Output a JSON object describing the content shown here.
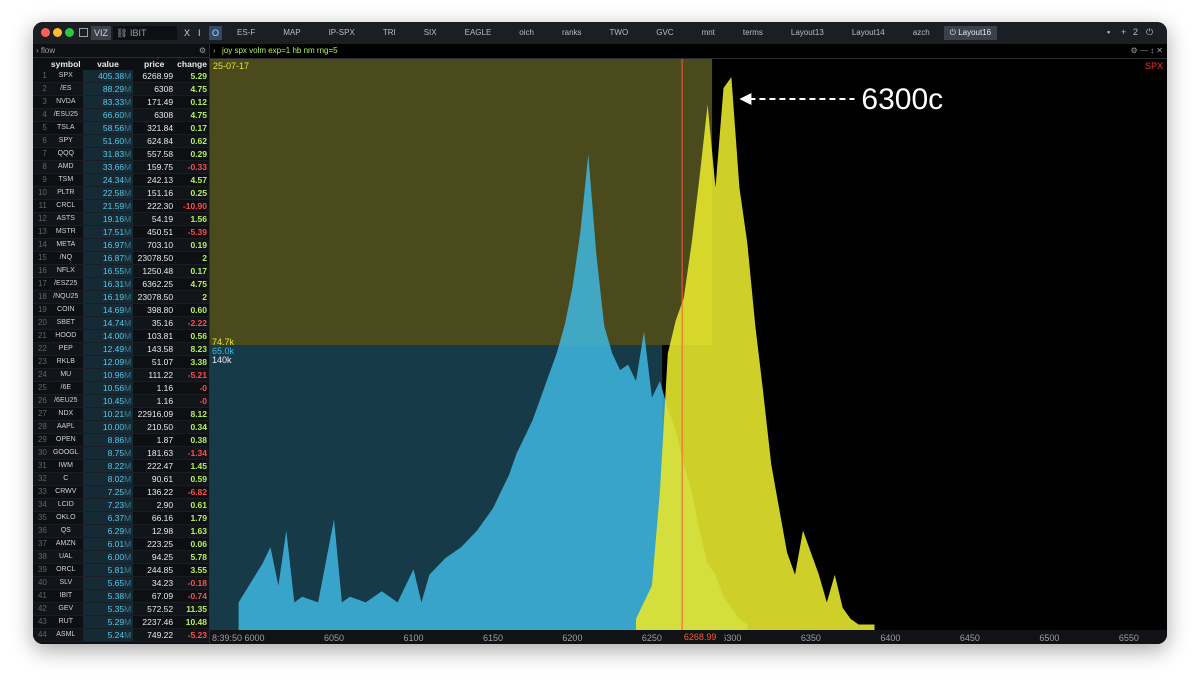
{
  "topbar": {
    "viz_label": "VIZ",
    "search_value": "IBIT",
    "x_label": "X",
    "i_label": "I",
    "o_label": "O",
    "tabs": [
      "ES-F",
      "MAP",
      "IP-SPX",
      "TRI",
      "SIX",
      "EAGLE",
      "oich",
      "ranks",
      "TWO",
      "GVC",
      "mnt",
      "terms",
      "Layout13",
      "Layout14",
      "azch",
      "Layout16"
    ],
    "active_tab": "Layout16",
    "layout_count": "2"
  },
  "flow": {
    "title": "flow",
    "columns": [
      "symbol",
      "value",
      "price",
      "change"
    ],
    "rows": [
      [
        "1",
        "SPX",
        "405.38",
        "M",
        "6268.99",
        "5.29"
      ],
      [
        "2",
        "/ES",
        "88.29",
        "M",
        "6308",
        "4.75"
      ],
      [
        "3",
        "NVDA",
        "83.33",
        "M",
        "171.49",
        "0.12"
      ],
      [
        "4",
        "/ESU25",
        "66.60",
        "M",
        "6308",
        "4.75"
      ],
      [
        "5",
        "TSLA",
        "58.56",
        "M",
        "321.84",
        "0.17"
      ],
      [
        "6",
        "SPY",
        "51.60",
        "M",
        "624.84",
        "0.62"
      ],
      [
        "7",
        "QQQ",
        "31.83",
        "M",
        "557.58",
        "0.29"
      ],
      [
        "8",
        "AMD",
        "33.66",
        "M",
        "159.75",
        "-0.33"
      ],
      [
        "9",
        "TSM",
        "24.34",
        "M",
        "242.13",
        "4.57"
      ],
      [
        "10",
        "PLTR",
        "22.58",
        "M",
        "151.16",
        "0.25"
      ],
      [
        "11",
        "CRCL",
        "21.59",
        "M",
        "222.30",
        "-10.90"
      ],
      [
        "12",
        "ASTS",
        "19.16",
        "M",
        "54.19",
        "1.56"
      ],
      [
        "13",
        "MSTR",
        "17.51",
        "M",
        "450.51",
        "-5.39"
      ],
      [
        "14",
        "META",
        "16.97",
        "M",
        "703.10",
        "0.19"
      ],
      [
        "15",
        "/NQ",
        "16.87",
        "M",
        "23078.50",
        "2"
      ],
      [
        "16",
        "NFLX",
        "16.55",
        "M",
        "1250.48",
        "0.17"
      ],
      [
        "17",
        "/ESZ25",
        "16.31",
        "M",
        "6362.25",
        "4.75"
      ],
      [
        "18",
        "/NQU25",
        "16.19",
        "M",
        "23078.50",
        "2"
      ],
      [
        "19",
        "COIN",
        "14.69",
        "M",
        "398.80",
        "0.60"
      ],
      [
        "20",
        "SBET",
        "14.74",
        "M",
        "35.16",
        "-2.22"
      ],
      [
        "21",
        "HOOD",
        "14.00",
        "M",
        "103.81",
        "0.56"
      ],
      [
        "22",
        "PEP",
        "12.49",
        "M",
        "143.58",
        "8.23"
      ],
      [
        "23",
        "RKLB",
        "12.09",
        "M",
        "51.07",
        "3.38"
      ],
      [
        "24",
        "MU",
        "10.96",
        "M",
        "111.22",
        "-5.21"
      ],
      [
        "25",
        "/6E",
        "10.56",
        "M",
        "1.16",
        "-0"
      ],
      [
        "26",
        "/6EU25",
        "10.45",
        "M",
        "1.16",
        "-0"
      ],
      [
        "27",
        "NDX",
        "10.21",
        "M",
        "22916.09",
        "8.12"
      ],
      [
        "28",
        "AAPL",
        "10.00",
        "M",
        "210.50",
        "0.34"
      ],
      [
        "29",
        "OPEN",
        "8.86",
        "M",
        "1.87",
        "0.38"
      ],
      [
        "30",
        "GOOGL",
        "8.75",
        "M",
        "181.63",
        "-1.34"
      ],
      [
        "31",
        "IWM",
        "8.22",
        "M",
        "222.47",
        "1.45"
      ],
      [
        "32",
        "C",
        "8.02",
        "M",
        "90.61",
        "0.59"
      ],
      [
        "33",
        "CRWV",
        "7.25",
        "M",
        "136.22",
        "-6.82"
      ],
      [
        "34",
        "LCID",
        "7.23",
        "M",
        "2.90",
        "0.61"
      ],
      [
        "35",
        "OKLO",
        "6.37",
        "M",
        "66.16",
        "1.79"
      ],
      [
        "36",
        "QS",
        "6.29",
        "M",
        "12.98",
        "1.63"
      ],
      [
        "37",
        "AMZN",
        "6.01",
        "M",
        "223.25",
        "0.06"
      ],
      [
        "38",
        "UAL",
        "6.00",
        "M",
        "94.25",
        "5.78"
      ],
      [
        "39",
        "ORCL",
        "5.81",
        "M",
        "244.85",
        "3.55"
      ],
      [
        "40",
        "SLV",
        "5.65",
        "M",
        "34.23",
        "-0.18"
      ],
      [
        "41",
        "IBIT",
        "5.38",
        "M",
        "67.09",
        "-0.74"
      ],
      [
        "42",
        "GEV",
        "5.35",
        "M",
        "572.52",
        "11.35"
      ],
      [
        "43",
        "RUT",
        "5.29",
        "M",
        "2237.46",
        "10.48"
      ],
      [
        "44",
        "ASML",
        "5.24",
        "M",
        "749.22",
        "-5.23"
      ]
    ]
  },
  "chart": {
    "command": "joy spx volm exp=1 hb nm rng=5",
    "date": "25-07-17",
    "symbol": "SPX",
    "annotation": "6300c",
    "level_labels": [
      "74.7k",
      "65.0k",
      "140k"
    ],
    "time": "8:39:50",
    "current_price_label": "6268.99",
    "colors": {
      "calls": "#e6e62e",
      "puts": "#3fb7e0",
      "current_price": "#ff5a3c",
      "symbol": "#ff3030"
    }
  },
  "chart_data": {
    "type": "area",
    "x_ticks": [
      "6000",
      "6050",
      "6100",
      "6150",
      "6200",
      "6250",
      "6300",
      "6350",
      "6400",
      "6450",
      "6500",
      "6550"
    ],
    "xlim": [
      5972,
      6574
    ],
    "current_price": 6268.99,
    "level_values": [
      74.7,
      65.0,
      140
    ],
    "series": [
      {
        "name": "",
        "strikes": [
          5990,
          6005,
          6010,
          6015,
          6020,
          6025,
          6030,
          6040,
          6050,
          6055,
          6060,
          6070,
          6080,
          6090,
          6100,
          6105,
          6110,
          6120,
          6130,
          6140,
          6150,
          6155,
          6160,
          6165,
          6170,
          6175,
          6180,
          6185,
          6190,
          6195,
          6200,
          6205,
          6210,
          6215,
          6220,
          6225,
          6230,
          6235,
          6240,
          6245,
          6250,
          6255,
          6260,
          6265,
          6270,
          6275,
          6280,
          6285,
          6290,
          6295,
          6300,
          6305,
          6310
        ],
        "values": [
          0.05,
          0.12,
          0.15,
          0.08,
          0.18,
          0.05,
          0.06,
          0.05,
          0.2,
          0.05,
          0.06,
          0.05,
          0.07,
          0.05,
          0.11,
          0.05,
          0.1,
          0.13,
          0.15,
          0.18,
          0.22,
          0.25,
          0.28,
          0.32,
          0.35,
          0.38,
          0.42,
          0.46,
          0.5,
          0.55,
          0.62,
          0.72,
          0.86,
          0.68,
          0.55,
          0.5,
          0.47,
          0.48,
          0.45,
          0.54,
          0.42,
          0.45,
          0.4,
          0.36,
          0.3,
          0.25,
          0.18,
          0.12,
          0.1,
          0.06,
          0.04,
          0.02,
          0.01
        ]
      },
      {
        "name": "",
        "strikes": [
          6240,
          6250,
          6255,
          6260,
          6265,
          6270,
          6275,
          6280,
          6285,
          6290,
          6295,
          6300,
          6305,
          6310,
          6315,
          6320,
          6325,
          6330,
          6335,
          6340,
          6345,
          6350,
          6355,
          6360,
          6365,
          6370,
          6375,
          6380,
          6390
        ],
        "values": [
          0.02,
          0.08,
          0.25,
          0.5,
          0.56,
          0.6,
          0.7,
          0.82,
          0.95,
          0.8,
          0.98,
          1.0,
          0.8,
          0.7,
          0.55,
          0.43,
          0.3,
          0.22,
          0.14,
          0.1,
          0.18,
          0.14,
          0.1,
          0.05,
          0.1,
          0.04,
          0.02,
          0.01,
          0.01
        ]
      }
    ]
  }
}
